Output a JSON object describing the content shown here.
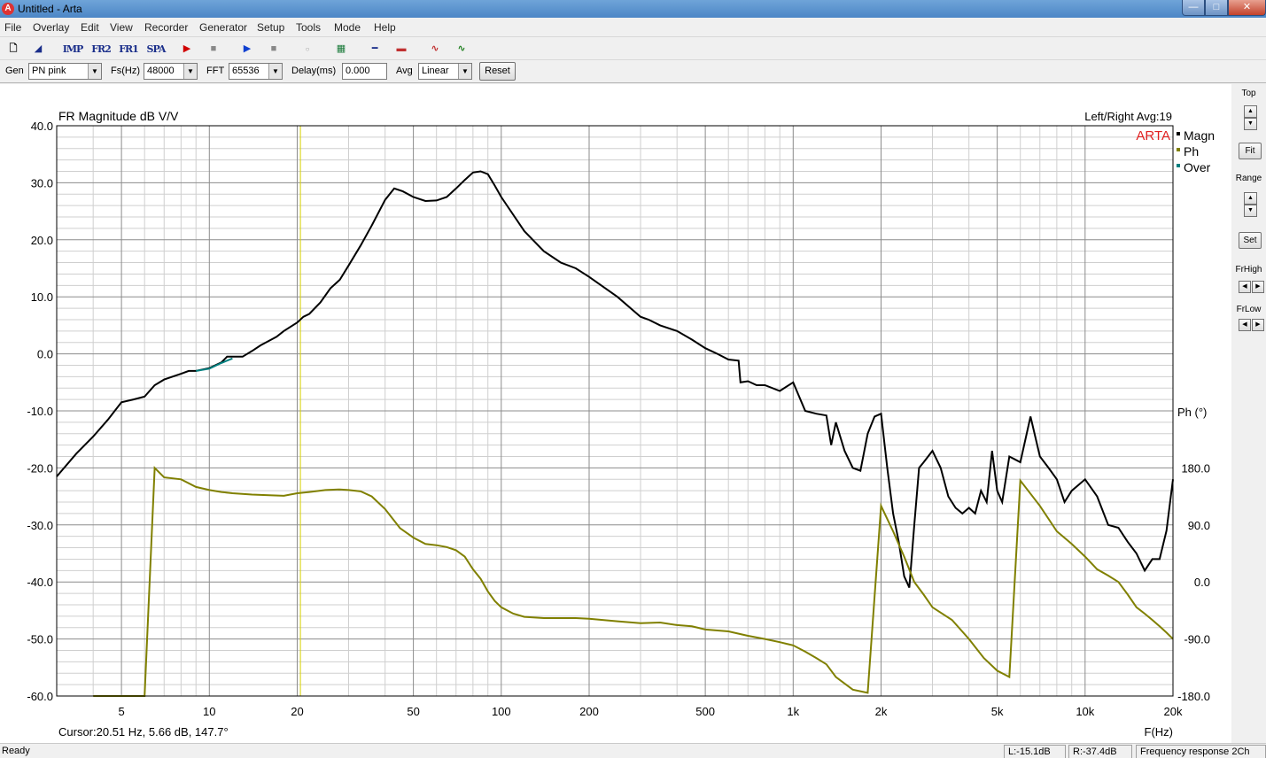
{
  "window": {
    "title": "Untitled - Arta",
    "icon": "arta-app-icon"
  },
  "menu": [
    "File",
    "Overlay",
    "Edit",
    "View",
    "Recorder",
    "Generator",
    "Setup",
    "Tools",
    "Mode",
    "Help"
  ],
  "toolbar": {
    "imp": "IMP",
    "fr2": "FR2",
    "fr1": "FR1",
    "spa": "SPA",
    "icons": [
      "new-doc-icon",
      "open-icon",
      "record-red-icon",
      "stop-icon",
      "play-blue-icon",
      "stop2-icon",
      "abc-icon",
      "chart-icon",
      "probe-icon",
      "colorbar-icon",
      "signal-icon",
      "signal-green-icon"
    ]
  },
  "controls": {
    "gen_label": "Gen",
    "gen_value": "PN pink",
    "fs_label": "Fs(Hz)",
    "fs_value": "48000",
    "fft_label": "FFT",
    "fft_value": "65536",
    "delay_label": "Delay(ms)",
    "delay_value": "0.000",
    "avg_label": "Avg",
    "avg_value": "Linear",
    "reset_label": "Reset"
  },
  "chart_data": {
    "type": "line",
    "title": "FR Magnitude dB V/V",
    "subtitle": "Left/Right  Avg:19",
    "watermark": "ARTA",
    "xlabel": "F(Hz)",
    "ylabel_right": "Ph (°)",
    "x_scale": "log",
    "xlim": [
      3,
      20000
    ],
    "ylim": [
      -60,
      40
    ],
    "y2lim": [
      -180,
      180
    ],
    "grid": true,
    "legend_position": "top-right",
    "x_ticks": [
      {
        "v": 5,
        "label": "5"
      },
      {
        "v": 10,
        "label": "10"
      },
      {
        "v": 20,
        "label": "20"
      },
      {
        "v": 50,
        "label": "50"
      },
      {
        "v": 100,
        "label": "100"
      },
      {
        "v": 200,
        "label": "200"
      },
      {
        "v": 500,
        "label": "500"
      },
      {
        "v": 1000,
        "label": "1k"
      },
      {
        "v": 2000,
        "label": "2k"
      },
      {
        "v": 5000,
        "label": "5k"
      },
      {
        "v": 10000,
        "label": "10k"
      },
      {
        "v": 20000,
        "label": "20k"
      }
    ],
    "y_ticks": [
      "40.0",
      "30.0",
      "20.0",
      "10.0",
      "0.0",
      "-10.0",
      "-20.0",
      "-30.0",
      "-40.0",
      "-50.0",
      "-60.0"
    ],
    "y_tick_values": [
      40,
      30,
      20,
      10,
      0,
      -10,
      -20,
      -30,
      -40,
      -50,
      -60
    ],
    "y2_ticks": [
      "180.0",
      "90.0",
      "0.0",
      "-90.0",
      "-180.0"
    ],
    "y2_tick_values": [
      180,
      90,
      0,
      -90,
      -180
    ],
    "cursor_x": 20.51,
    "cursor_text": "Cursor:20.51 Hz, 5.66 dB, 147.7°",
    "series": [
      {
        "name": "Magn",
        "color": "#000000",
        "points": [
          [
            3,
            -21.5
          ],
          [
            3.5,
            -17.5
          ],
          [
            4,
            -14.5
          ],
          [
            4.5,
            -11.5
          ],
          [
            5,
            -8.5
          ],
          [
            5.5,
            -8
          ],
          [
            6,
            -7.5
          ],
          [
            6.5,
            -5.5
          ],
          [
            7,
            -4.5
          ],
          [
            8,
            -3.5
          ],
          [
            8.5,
            -3
          ],
          [
            9,
            -3
          ],
          [
            10,
            -2.5
          ],
          [
            11,
            -1.5
          ],
          [
            11.5,
            -0.5
          ],
          [
            12.5,
            -0.5
          ],
          [
            13,
            -0.5
          ],
          [
            14,
            0.5
          ],
          [
            15,
            1.5
          ],
          [
            17,
            3
          ],
          [
            18,
            4
          ],
          [
            20,
            5.5
          ],
          [
            21,
            6.5
          ],
          [
            22,
            7
          ],
          [
            24,
            9
          ],
          [
            26,
            11.5
          ],
          [
            28,
            13
          ],
          [
            30,
            15.5
          ],
          [
            33,
            19
          ],
          [
            36,
            22.5
          ],
          [
            40,
            27
          ],
          [
            43,
            29
          ],
          [
            46,
            28.5
          ],
          [
            50,
            27.5
          ],
          [
            55,
            26.8
          ],
          [
            60,
            26.9
          ],
          [
            65,
            27.5
          ],
          [
            70,
            29
          ],
          [
            75,
            30.5
          ],
          [
            80,
            31.8
          ],
          [
            85,
            32
          ],
          [
            90,
            31.5
          ],
          [
            95,
            29.5
          ],
          [
            100,
            27.5
          ],
          [
            120,
            21.5
          ],
          [
            140,
            18
          ],
          [
            160,
            16
          ],
          [
            180,
            15
          ],
          [
            200,
            13.5
          ],
          [
            250,
            10
          ],
          [
            300,
            6.5
          ],
          [
            320,
            6
          ],
          [
            350,
            5
          ],
          [
            400,
            4
          ],
          [
            450,
            2.5
          ],
          [
            500,
            1
          ],
          [
            550,
            0
          ],
          [
            600,
            -1
          ],
          [
            650,
            -1.2
          ],
          [
            660,
            -5
          ],
          [
            700,
            -4.8
          ],
          [
            750,
            -5.5
          ],
          [
            800,
            -5.5
          ],
          [
            900,
            -6.5
          ],
          [
            1000,
            -5
          ],
          [
            1100,
            -10
          ],
          [
            1200,
            -10.5
          ],
          [
            1300,
            -10.8
          ],
          [
            1350,
            -16
          ],
          [
            1400,
            -12
          ],
          [
            1500,
            -17
          ],
          [
            1600,
            -20
          ],
          [
            1700,
            -20.5
          ],
          [
            1800,
            -14
          ],
          [
            1900,
            -11
          ],
          [
            2000,
            -10.5
          ],
          [
            2100,
            -20
          ],
          [
            2200,
            -28
          ],
          [
            2300,
            -33
          ],
          [
            2400,
            -39
          ],
          [
            2500,
            -41
          ],
          [
            2600,
            -30
          ],
          [
            2700,
            -20
          ],
          [
            2800,
            -19
          ],
          [
            3000,
            -17
          ],
          [
            3200,
            -20
          ],
          [
            3400,
            -25
          ],
          [
            3600,
            -27
          ],
          [
            3800,
            -28
          ],
          [
            4000,
            -27
          ],
          [
            4200,
            -28
          ],
          [
            4400,
            -24
          ],
          [
            4600,
            -26
          ],
          [
            4800,
            -17
          ],
          [
            5000,
            -24
          ],
          [
            5200,
            -26
          ],
          [
            5500,
            -18
          ],
          [
            6000,
            -19
          ],
          [
            6500,
            -11
          ],
          [
            7000,
            -18
          ],
          [
            7500,
            -20
          ],
          [
            8000,
            -22
          ],
          [
            8500,
            -26
          ],
          [
            9000,
            -24
          ],
          [
            10000,
            -22
          ],
          [
            11000,
            -25
          ],
          [
            12000,
            -30
          ],
          [
            13000,
            -30.5
          ],
          [
            14000,
            -33
          ],
          [
            15000,
            -35
          ],
          [
            16000,
            -38
          ],
          [
            17000,
            -36
          ],
          [
            18000,
            -36
          ],
          [
            19000,
            -31
          ],
          [
            20000,
            -22
          ]
        ]
      },
      {
        "name": "Ph",
        "color": "#808000",
        "points": [
          [
            4,
            -240
          ],
          [
            5,
            -280
          ],
          [
            6,
            -305
          ],
          [
            6.5,
            180
          ],
          [
            7,
            165
          ],
          [
            8,
            162
          ],
          [
            9,
            150
          ],
          [
            10,
            145
          ],
          [
            11,
            142
          ],
          [
            12,
            140
          ],
          [
            14,
            138
          ],
          [
            16,
            137
          ],
          [
            18,
            136
          ],
          [
            20,
            140
          ],
          [
            22,
            142
          ],
          [
            25,
            145
          ],
          [
            28,
            146
          ],
          [
            30,
            145
          ],
          [
            33,
            143
          ],
          [
            36,
            135
          ],
          [
            40,
            115
          ],
          [
            45,
            85
          ],
          [
            50,
            70
          ],
          [
            55,
            60
          ],
          [
            60,
            58
          ],
          [
            65,
            55
          ],
          [
            70,
            50
          ],
          [
            75,
            40
          ],
          [
            80,
            20
          ],
          [
            85,
            5
          ],
          [
            90,
            -15
          ],
          [
            95,
            -30
          ],
          [
            100,
            -40
          ],
          [
            110,
            -50
          ],
          [
            120,
            -55
          ],
          [
            140,
            -57
          ],
          [
            160,
            -57
          ],
          [
            180,
            -57
          ],
          [
            200,
            -58
          ],
          [
            250,
            -62
          ],
          [
            300,
            -65
          ],
          [
            350,
            -64
          ],
          [
            400,
            -68
          ],
          [
            450,
            -70
          ],
          [
            500,
            -75
          ],
          [
            600,
            -78
          ],
          [
            700,
            -85
          ],
          [
            800,
            -90
          ],
          [
            900,
            -95
          ],
          [
            1000,
            -100
          ],
          [
            1100,
            -110
          ],
          [
            1200,
            -120
          ],
          [
            1300,
            -130
          ],
          [
            1400,
            -150
          ],
          [
            1600,
            -170
          ],
          [
            1800,
            -175
          ],
          [
            2000,
            120
          ],
          [
            2200,
            80
          ],
          [
            2400,
            40
          ],
          [
            2600,
            0
          ],
          [
            2800,
            -20
          ],
          [
            3000,
            -40
          ],
          [
            3500,
            -60
          ],
          [
            4000,
            -90
          ],
          [
            4500,
            -120
          ],
          [
            5000,
            -140
          ],
          [
            5500,
            -150
          ],
          [
            6000,
            160
          ],
          [
            7000,
            120
          ],
          [
            8000,
            80
          ],
          [
            9000,
            60
          ],
          [
            10000,
            40
          ],
          [
            11000,
            20
          ],
          [
            12000,
            10
          ],
          [
            13000,
            0
          ],
          [
            14000,
            -20
          ],
          [
            15000,
            -40
          ],
          [
            16000,
            -50
          ],
          [
            17000,
            -60
          ],
          [
            18000,
            -70
          ],
          [
            19000,
            -80
          ],
          [
            20000,
            -90
          ]
        ]
      },
      {
        "name": "Over",
        "color": "#008080",
        "points": [
          [
            9,
            -3
          ],
          [
            10,
            -2.6
          ],
          [
            11,
            -1.6
          ],
          [
            12,
            -0.8
          ]
        ]
      }
    ]
  },
  "right_panel": {
    "top_label": "Top",
    "fit_label": "Fit",
    "range_label": "Range",
    "set_label": "Set",
    "frhigh_label": "FrHigh",
    "frlow_label": "FrLow"
  },
  "status": {
    "ready": "Ready",
    "left_level": "L:-15.1dB",
    "right_level": "R:-37.4dB",
    "mode": "Frequency response 2Ch"
  }
}
